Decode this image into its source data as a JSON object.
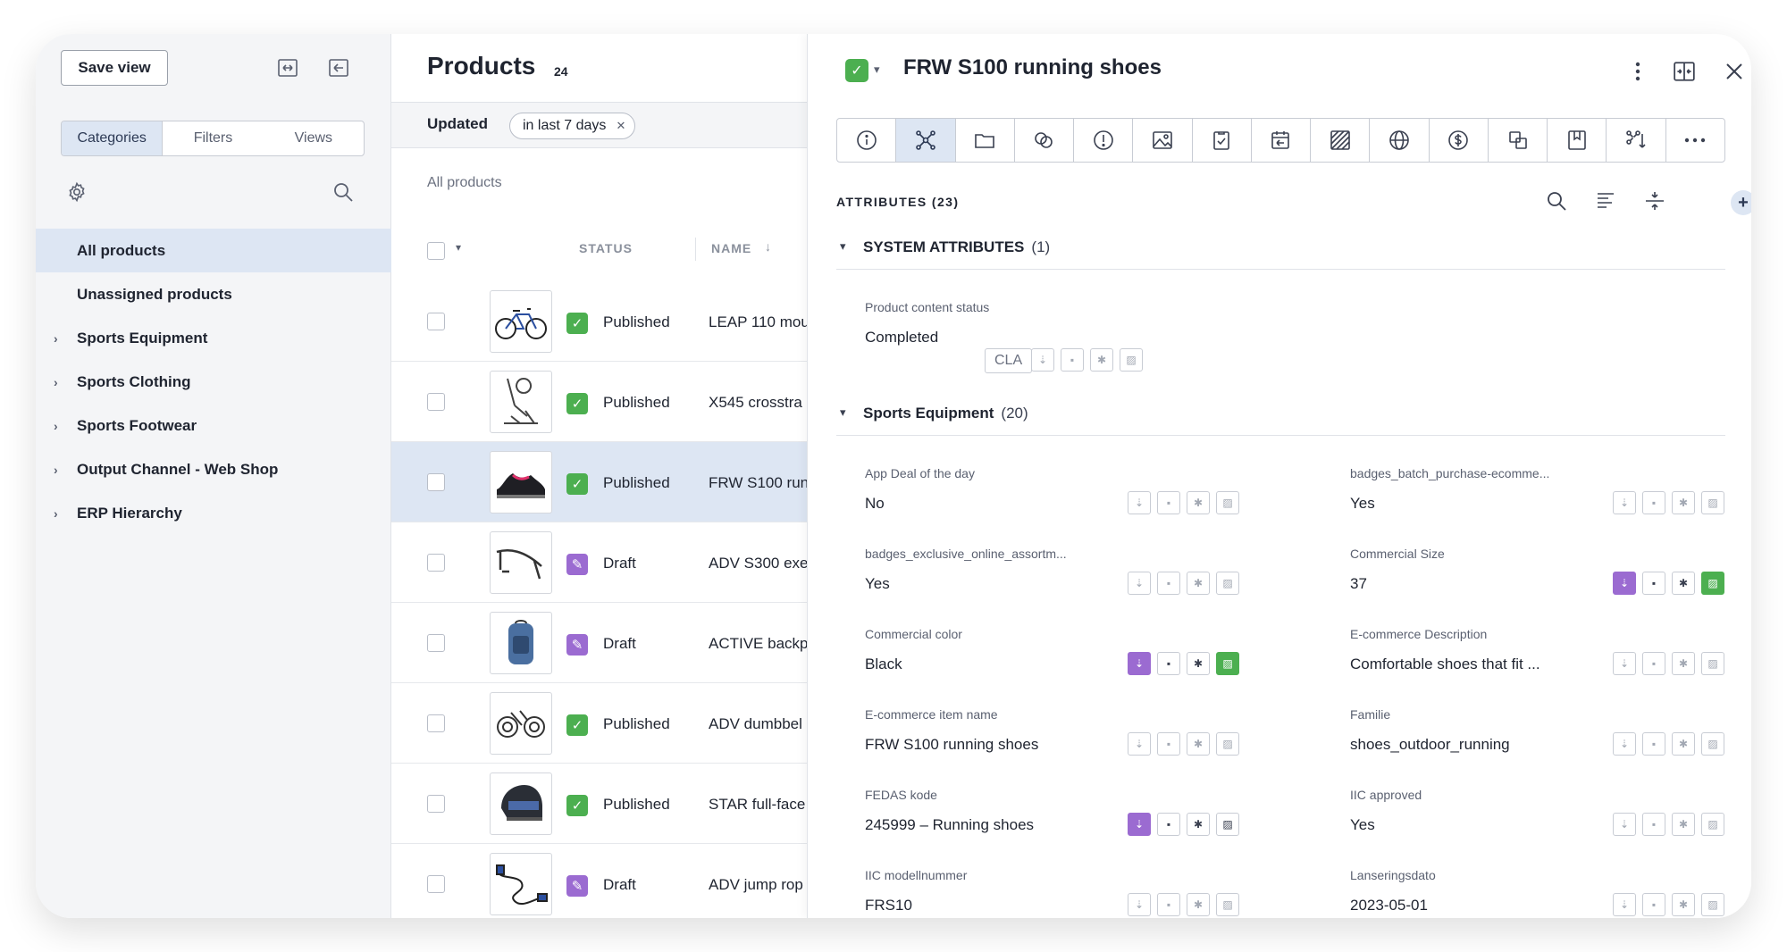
{
  "sidebar": {
    "save_view": "Save view",
    "tabs": [
      "Categories",
      "Filters",
      "Views"
    ],
    "items": [
      {
        "label": "All products",
        "has_children": false
      },
      {
        "label": "Unassigned products",
        "has_children": false
      },
      {
        "label": "Sports Equipment",
        "has_children": true
      },
      {
        "label": "Sports Clothing",
        "has_children": true
      },
      {
        "label": "Sports Footwear",
        "has_children": true
      },
      {
        "label": "Output Channel - Web Shop",
        "has_children": true
      },
      {
        "label": "ERP Hierarchy",
        "has_children": true
      }
    ]
  },
  "list": {
    "title": "Products",
    "count": "24",
    "filter_label": "Updated",
    "filter_chip": "in last 7 days",
    "section_label": "All products",
    "col_status": "STATUS",
    "col_name": "NAME",
    "rows": [
      {
        "status": "Published",
        "name": "LEAP 110 mou",
        "kind": "bike"
      },
      {
        "status": "Published",
        "name": "X545 crosstra",
        "kind": "trainer"
      },
      {
        "status": "Published",
        "name": "FRW S100 run",
        "kind": "shoe"
      },
      {
        "status": "Draft",
        "name": "ADV S300 exe",
        "kind": "bench"
      },
      {
        "status": "Draft",
        "name": "ACTIVE backp",
        "kind": "backpack"
      },
      {
        "status": "Published",
        "name": "ADV dumbbel",
        "kind": "dumbbell"
      },
      {
        "status": "Published",
        "name": "STAR full-face",
        "kind": "helmet"
      },
      {
        "status": "Draft",
        "name": "ADV jump rop",
        "kind": "rope"
      }
    ]
  },
  "panel": {
    "title": "FRW S100 running shoes",
    "attributes_header": "ATTRIBUTES (23)",
    "system_section": {
      "title": "SYSTEM ATTRIBUTES",
      "count": "(1)"
    },
    "system_field": {
      "label": "Product content status",
      "value": "Completed",
      "chip": "CLA"
    },
    "equipment_section": {
      "title": "Sports Equipment",
      "count": "(20)"
    },
    "fields": [
      {
        "label": "App Deal of the day",
        "value": "No",
        "flags": "plain"
      },
      {
        "label": "badges_batch_purchase-ecomme...",
        "value": "Yes",
        "flags": "plain"
      },
      {
        "label": "badges_exclusive_online_assortm...",
        "value": "Yes",
        "flags": "plain"
      },
      {
        "label": "Commercial Size",
        "value": "37",
        "flags": "purple-green"
      },
      {
        "label": "Commercial color",
        "value": "Black",
        "flags": "purple-green"
      },
      {
        "label": "E-commerce Description",
        "value": "Comfortable shoes that fit ...",
        "flags": "plain"
      },
      {
        "label": "E-commerce item name",
        "value": "FRW S100 running shoes",
        "flags": "plain"
      },
      {
        "label": "Familie",
        "value": "shoes_outdoor_running",
        "flags": "plain"
      },
      {
        "label": "FEDAS kode",
        "value": "245999 – Running shoes",
        "flags": "purple"
      },
      {
        "label": "IIC approved",
        "value": "Yes",
        "flags": "plain"
      },
      {
        "label": "IIC modellnummer",
        "value": "FRS10",
        "flags": "plain"
      },
      {
        "label": "Lanseringsdato",
        "value": "2023-05-01",
        "flags": "plain"
      }
    ]
  },
  "colors": {
    "published": "#4caf50",
    "draft": "#9b6bd1",
    "selection": "#dde6f3"
  }
}
